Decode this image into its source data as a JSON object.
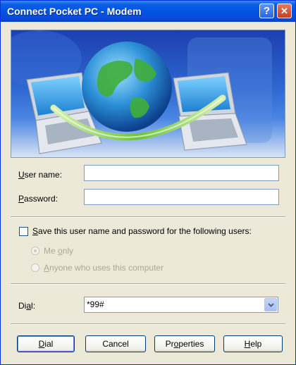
{
  "window": {
    "title": "Connect Pocket PC - Modem"
  },
  "titlebar_buttons": {
    "help": "?",
    "close": "✕"
  },
  "form": {
    "username_label": {
      "pre": "",
      "key": "U",
      "post": "ser name:"
    },
    "username_value": "",
    "password_label": {
      "pre": "",
      "key": "P",
      "post": "assword:"
    },
    "password_value": ""
  },
  "save": {
    "checkbox_label": {
      "pre": "",
      "key": "S",
      "post": "ave this user name and password for the following users:"
    },
    "checked": false,
    "options": [
      {
        "pre": "Me ",
        "key": "o",
        "post": "nly",
        "selected": true
      },
      {
        "pre": "",
        "key": "A",
        "post": "nyone who uses this computer",
        "selected": false
      }
    ]
  },
  "dial": {
    "label": {
      "pre": "Di",
      "key": "a",
      "post": "l:"
    },
    "value": "*99#"
  },
  "buttons": {
    "dial": {
      "pre": "",
      "key": "D",
      "post": "ial"
    },
    "cancel": "Cancel",
    "properties": {
      "pre": "Pr",
      "key": "o",
      "post": "perties"
    },
    "help": {
      "pre": "",
      "key": "H",
      "post": "elp"
    }
  }
}
